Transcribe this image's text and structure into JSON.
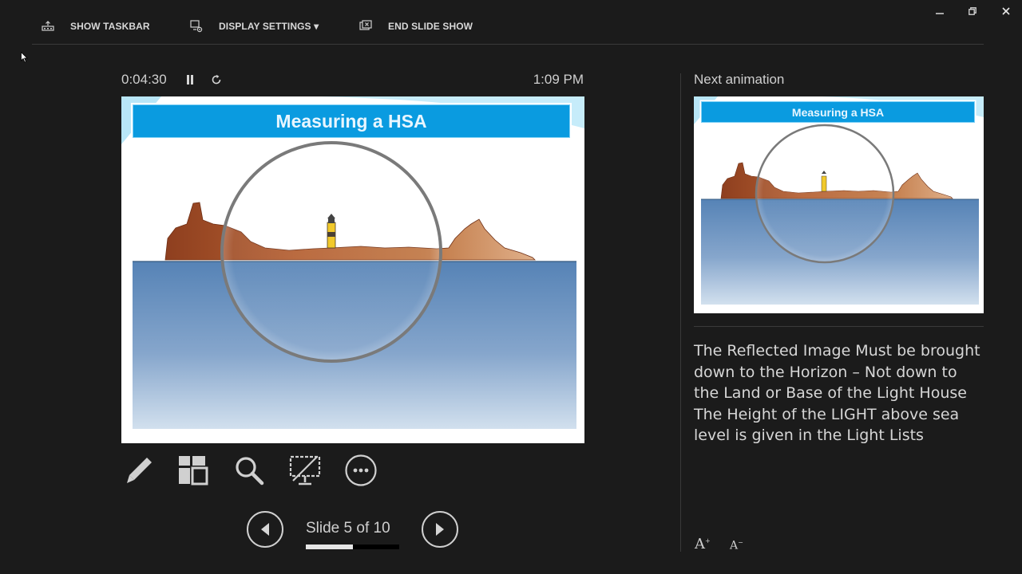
{
  "toolbar": {
    "show_taskbar": "SHOW TASKBAR",
    "display_settings": "DISPLAY SETTINGS ▾",
    "end_slide_show": "END SLIDE SHOW"
  },
  "window_controls": {
    "icons": [
      "minimize-icon",
      "restore-icon",
      "close-icon"
    ]
  },
  "timer": {
    "elapsed": "0:04:30",
    "clock": "1:09 PM",
    "icons": [
      "pause-icon",
      "restart-timer-icon"
    ]
  },
  "current_slide": {
    "title": "Measuring a HSA"
  },
  "tools": [
    "pen-icon",
    "see-all-slides-icon",
    "zoom-icon",
    "black-screen-icon",
    "more-options-icon"
  ],
  "navigation": {
    "counter": "Slide 5 of 10",
    "current": 5,
    "total": 10,
    "progress": 0.5
  },
  "next_pane": {
    "label": "Next animation",
    "preview_title": "Measuring a HSA"
  },
  "notes": [
    "The Reflected Image Must be brought down to the Horizon – Not down to the Land or Base of the Light House",
    "The Height of the LIGHT above sea level is given in the Light Lists"
  ],
  "font_controls": {
    "increase": "A",
    "decrease": "A"
  },
  "colors": {
    "background": "#1b1b1b",
    "title_bar": "#0a9be0",
    "sea_top": "#5a88b8",
    "land": "#9c4e2a"
  }
}
